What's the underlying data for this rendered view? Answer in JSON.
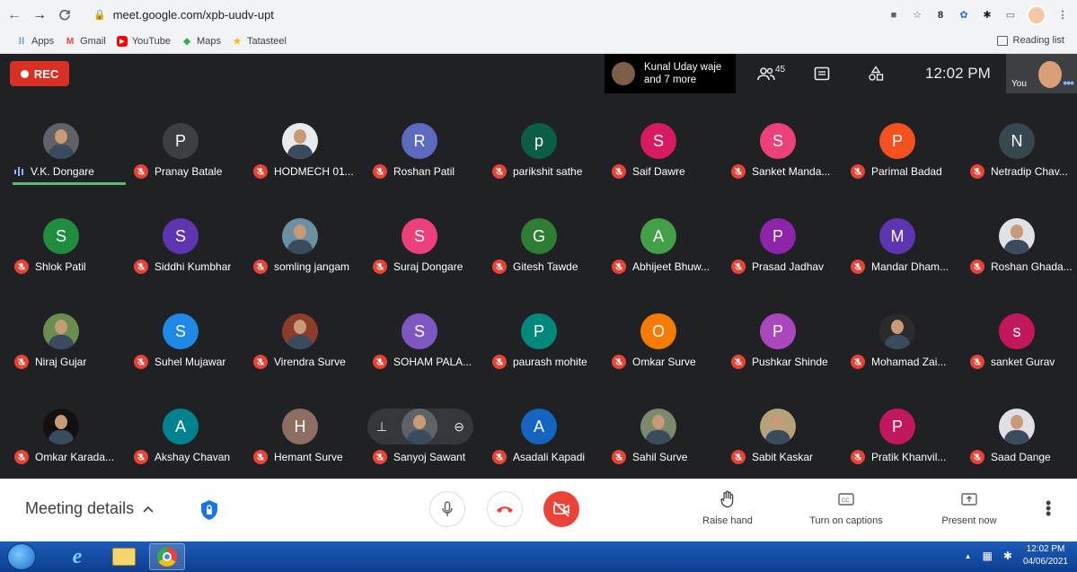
{
  "browser": {
    "url": "meet.google.com/xpb-uudv-upt",
    "bookmarks": [
      {
        "label": "Apps",
        "icon": "apps-grid-icon"
      },
      {
        "label": "Gmail",
        "icon": "gmail-icon"
      },
      {
        "label": "YouTube",
        "icon": "youtube-icon"
      },
      {
        "label": "Maps",
        "icon": "maps-icon"
      },
      {
        "label": "Tatasteel",
        "icon": "star-bookmark-icon"
      }
    ],
    "reading_list": "Reading list"
  },
  "meet_top": {
    "rec_label": "REC",
    "speaker_line1": "Kunal Uday waje",
    "speaker_line2": "and 7 more",
    "people_count": "45",
    "clock": "12:02 PM",
    "you_label": "You"
  },
  "participants": [
    {
      "name": "V.K. Dongare",
      "initial": "",
      "color": "#5f6368",
      "photo": true,
      "speaking": true
    },
    {
      "name": "Pranay Batale",
      "initial": "P",
      "color": "#3c4043"
    },
    {
      "name": "HODMECH 01...",
      "initial": "",
      "color": "#e8eaed",
      "photo": true
    },
    {
      "name": "Roshan Patil",
      "initial": "R",
      "color": "#5c6bc0"
    },
    {
      "name": "parikshit sathe",
      "initial": "p",
      "color": "#0b5e43"
    },
    {
      "name": "Saif Dawre",
      "initial": "S",
      "color": "#d81b60"
    },
    {
      "name": "Sanket Manda...",
      "initial": "S",
      "color": "#ec407a"
    },
    {
      "name": "Parimal Badad",
      "initial": "P",
      "color": "#f4511e"
    },
    {
      "name": "Netradip Chav...",
      "initial": "N",
      "color": "#37474f"
    },
    {
      "name": "Shlok Patil",
      "initial": "S",
      "color": "#1e8e3e"
    },
    {
      "name": "Siddhi Kumbhar",
      "initial": "S",
      "color": "#5e35b1"
    },
    {
      "name": "somling jangam",
      "initial": "",
      "color": "#6d8fa3",
      "photo": true
    },
    {
      "name": "Suraj Dongare",
      "initial": "S",
      "color": "#ec407a"
    },
    {
      "name": "Gitesh Tawde",
      "initial": "G",
      "color": "#2e7d32"
    },
    {
      "name": "Abhijeet Bhuw...",
      "initial": "A",
      "color": "#43a047"
    },
    {
      "name": "Prasad Jadhav",
      "initial": "P",
      "color": "#8e24aa"
    },
    {
      "name": "Mandar Dham...",
      "initial": "M",
      "color": "#5e35b1"
    },
    {
      "name": "Roshan Ghada...",
      "initial": "",
      "color": "#dfe3e6",
      "photo": true
    },
    {
      "name": "Niraj Gujar",
      "initial": "",
      "color": "#6b8e4e",
      "photo": true
    },
    {
      "name": "Suhel Mujawar",
      "initial": "S",
      "color": "#1e88e5"
    },
    {
      "name": "Virendra Surve",
      "initial": "",
      "color": "#8d3b2b",
      "photo": true
    },
    {
      "name": "SOHAM PALA...",
      "initial": "S",
      "color": "#7e57c2"
    },
    {
      "name": "paurash mohite",
      "initial": "P",
      "color": "#00897b"
    },
    {
      "name": "Omkar Surve",
      "initial": "O",
      "color": "#f57c00"
    },
    {
      "name": "Pushkar Shinde",
      "initial": "P",
      "color": "#ab47bc"
    },
    {
      "name": "Mohamad Zai...",
      "initial": "",
      "color": "#2b2b2b",
      "photo": true
    },
    {
      "name": "sanket Gurav",
      "initial": "s",
      "color": "#c2185b"
    },
    {
      "name": "Omkar Karada...",
      "initial": "",
      "color": "#111111",
      "photo": true
    },
    {
      "name": "Akshay Chavan",
      "initial": "A",
      "color": "#00838f"
    },
    {
      "name": "Hemant Surve",
      "initial": "H",
      "color": "#8d6e63"
    },
    {
      "name": "Sanyoj Sawant",
      "initial": "",
      "color": "#5f6368",
      "photo": true,
      "hover": true
    },
    {
      "name": "Asadali Kapadi",
      "initial": "A",
      "color": "#1565c0"
    },
    {
      "name": "Sahil Surve",
      "initial": "",
      "color": "#7a8a6a",
      "photo": true
    },
    {
      "name": "Sabit Kaskar",
      "initial": "",
      "color": "#b5a27a",
      "photo": true
    },
    {
      "name": "Pratik Khanvil...",
      "initial": "P",
      "color": "#c2185b"
    },
    {
      "name": "Saad Dange",
      "initial": "",
      "color": "#e0dfe3",
      "photo": true
    }
  ],
  "bottom": {
    "meeting_details": "Meeting details",
    "raise_hand": "Raise hand",
    "captions": "Turn on captions",
    "present": "Present now"
  },
  "taskbar": {
    "time": "12:02 PM",
    "date": "04/06/2021"
  },
  "colors": {
    "meet_bg": "#202124",
    "muted_red": "#ea4335",
    "rec_red": "#d93025",
    "speaking_green": "#5bb974"
  }
}
